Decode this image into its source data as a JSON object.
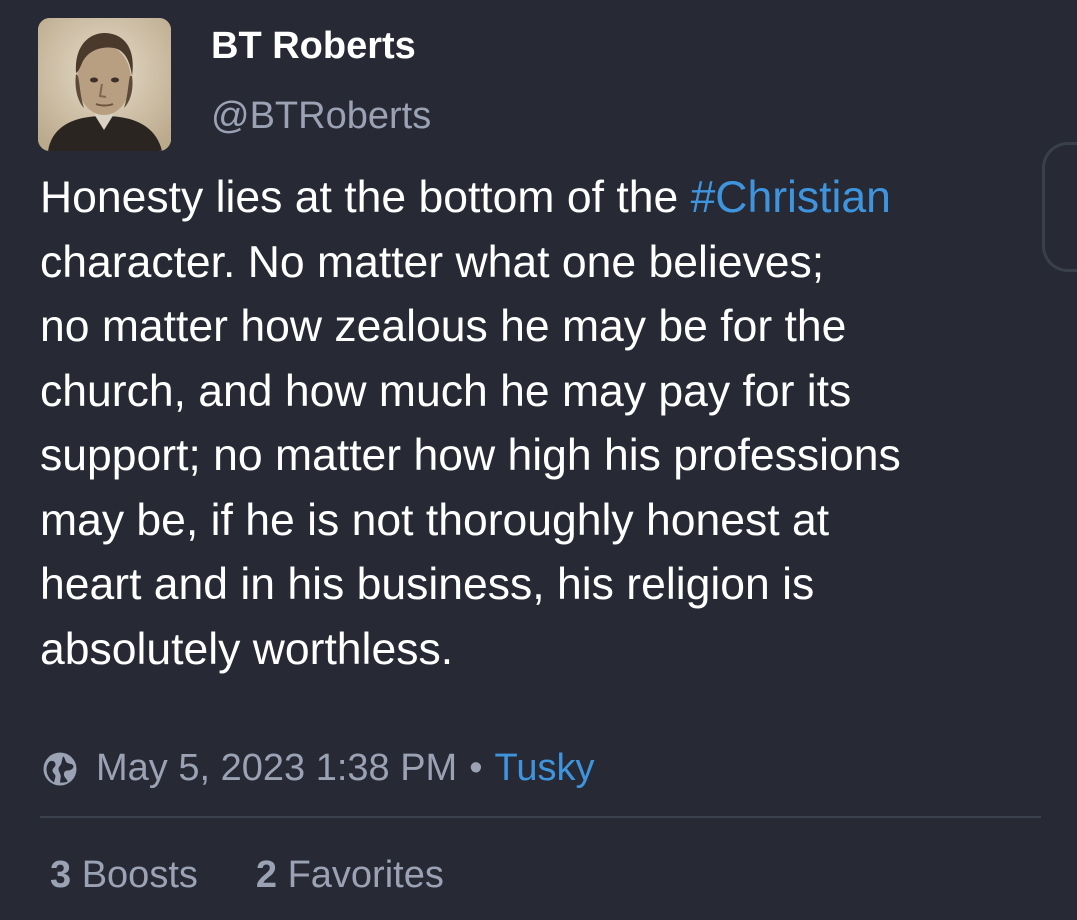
{
  "account": {
    "display_name": "BT Roberts",
    "handle": "@BTRoberts",
    "avatar_icon": "portrait-photo"
  },
  "status": {
    "text_before": "Honesty lies at the bottom of the ",
    "hashtag": "#Christian",
    "lines": [
      "character. No matter what one believes;",
      "no matter how zealous he may be for the",
      "church, and how much he may pay for its",
      "support; no matter how high his professions",
      "may be, if he is not thoroughly honest at",
      "heart and in his business, his religion is",
      "absolutely worthless."
    ],
    "visibility_icon": "globe-icon",
    "timestamp": "May 5, 2023 1:38 PM",
    "separator": "•",
    "application": "Tusky"
  },
  "stats": {
    "boosts_count": "3",
    "boosts_label": "Boosts",
    "favorites_count": "2",
    "favorites_label": "Favorites"
  },
  "colors": {
    "background": "#272a35",
    "text": "#ffffff",
    "secondary": "#9aa2b4",
    "accent": "#3e95de"
  }
}
